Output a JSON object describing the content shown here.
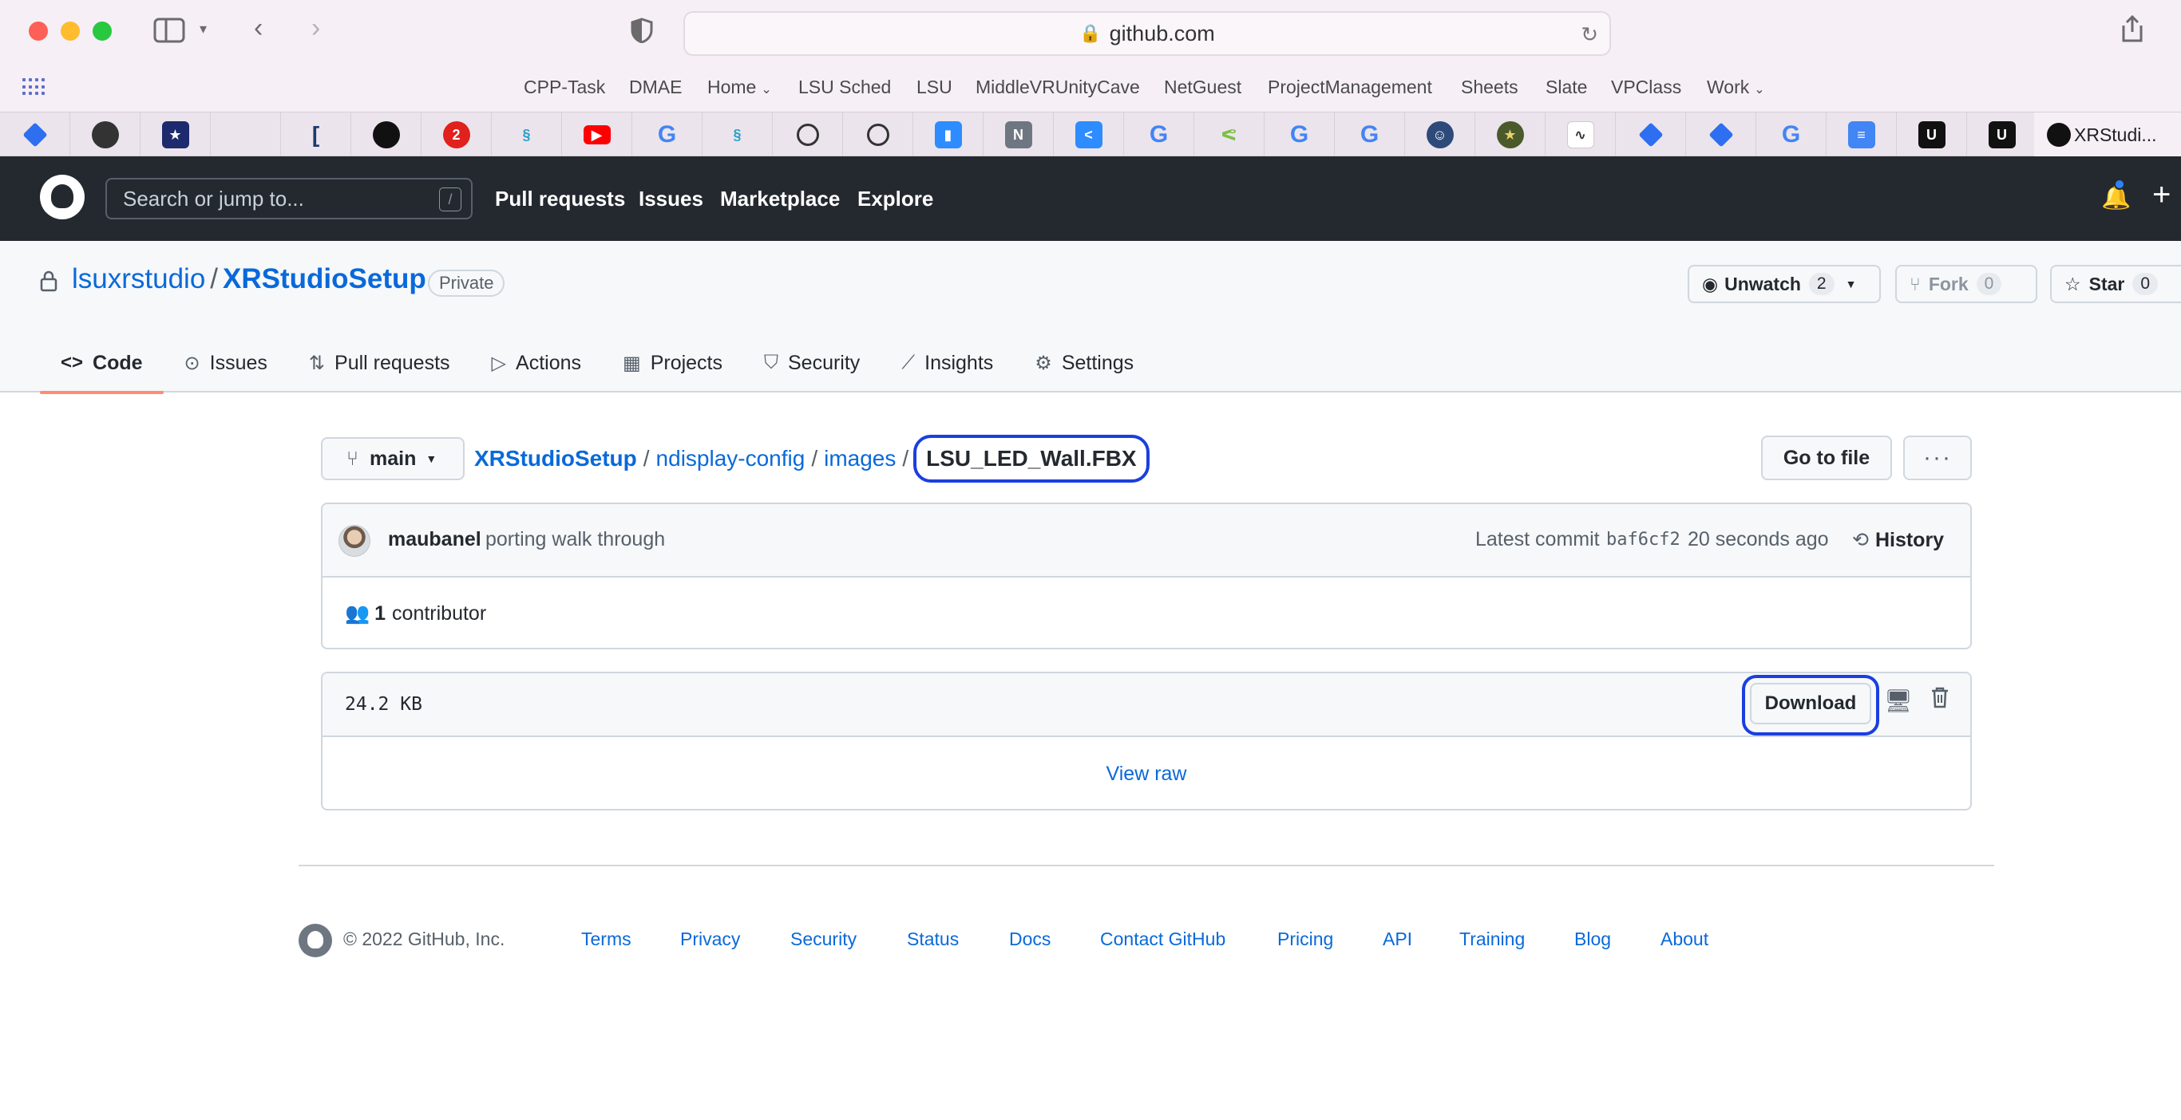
{
  "browser": {
    "url": "github.com",
    "favorites": [
      "CPP-Task",
      "DMAE",
      "Home",
      "LSU Sched",
      "LSU",
      "MiddleVRUnityCave",
      "NetGuest",
      "ProjectManagement",
      "Sheets",
      "Slate",
      "VPClass",
      "Work"
    ],
    "active_tab_title": "XRStudi..."
  },
  "gh_header": {
    "search_placeholder": "Search or jump to...",
    "search_shortcut": "/",
    "nav": [
      "Pull requests",
      "Issues",
      "Marketplace",
      "Explore"
    ]
  },
  "repo": {
    "owner": "lsuxrstudio",
    "separator": "/",
    "name": "XRStudioSetup",
    "visibility": "Private",
    "unwatch_label": "Unwatch",
    "unwatch_count": "2",
    "fork_label": "Fork",
    "fork_count": "0",
    "star_label": "Star",
    "star_count": "0",
    "tabs": [
      "Code",
      "Issues",
      "Pull requests",
      "Actions",
      "Projects",
      "Security",
      "Insights",
      "Settings"
    ]
  },
  "file": {
    "branch": "main",
    "path_root": "XRStudioSetup",
    "path_dirs": [
      "ndisplay-config",
      "images"
    ],
    "filename": "LSU_LED_Wall.FBX",
    "go_to_file": "Go to file",
    "more": "···",
    "commit_author": "maubanel",
    "commit_message": "porting walk through",
    "latest_commit_label": "Latest commit",
    "commit_sha": "baf6cf2",
    "commit_time": "20 seconds ago",
    "history_label": "History",
    "contributors_count": "1",
    "contributors_label": "contributor",
    "size": "24.2 KB",
    "download_label": "Download",
    "view_raw_label": "View raw"
  },
  "footer": {
    "copyright": "© 2022 GitHub, Inc.",
    "links": [
      "Terms",
      "Privacy",
      "Security",
      "Status",
      "Docs",
      "Contact GitHub",
      "Pricing",
      "API",
      "Training",
      "Blog",
      "About"
    ]
  },
  "colors": {
    "header_bg": "#24292f",
    "link": "#0969da",
    "annotation_ring": "#1a3fe0",
    "active_tab_underline": "#fd8c73"
  }
}
